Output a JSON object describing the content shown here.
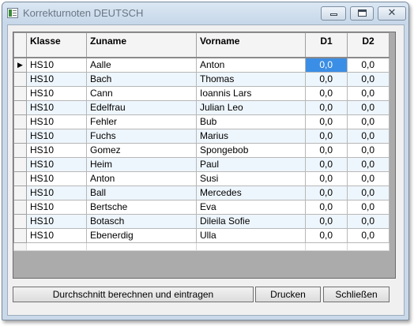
{
  "window": {
    "title": "Korrekturnoten DEUTSCH",
    "controls": {
      "minimize": "minimize",
      "maximize": "maximize",
      "close": "✕"
    }
  },
  "grid": {
    "columns": [
      "Klasse",
      "Zuname",
      "Vorname",
      "D1",
      "D2"
    ],
    "current_row_marker": "▶",
    "rows": [
      [
        "HS10",
        "Aalle",
        "Anton",
        "0,0",
        "0,0"
      ],
      [
        "HS10",
        "Bach",
        "Thomas",
        "0,0",
        "0,0"
      ],
      [
        "HS10",
        "Cann",
        "Ioannis Lars",
        "0,0",
        "0,0"
      ],
      [
        "HS10",
        "Edelfrau",
        "Julian Leo",
        "0,0",
        "0,0"
      ],
      [
        "HS10",
        "Fehler",
        "Bub",
        "0,0",
        "0,0"
      ],
      [
        "HS10",
        "Fuchs",
        "Marius",
        "0,0",
        "0,0"
      ],
      [
        "HS10",
        "Gomez",
        "Spongebob",
        "0,0",
        "0,0"
      ],
      [
        "HS10",
        "Heim",
        "Paul",
        "0,0",
        "0,0"
      ],
      [
        "HS10",
        "Anton",
        "Susi",
        "0,0",
        "0,0"
      ],
      [
        "HS10",
        "Ball",
        "Mercedes",
        "0,0",
        "0,0"
      ],
      [
        "HS10",
        "Bertsche",
        "Eva",
        "0,0",
        "0,0"
      ],
      [
        "HS10",
        "Botasch",
        "Dileila Sofie",
        "0,0",
        "0,0"
      ],
      [
        "HS10",
        "Ebenerdig",
        "Ulla",
        "0,0",
        "0,0"
      ]
    ]
  },
  "buttons": {
    "calculate": "Durchschnitt berechnen und eintragen",
    "print": "Drucken",
    "close": "Schließen"
  },
  "colors": {
    "selection": "#3b8ee5",
    "alt_row": "#eef6fd",
    "window_frame": "#c9d9ea"
  }
}
